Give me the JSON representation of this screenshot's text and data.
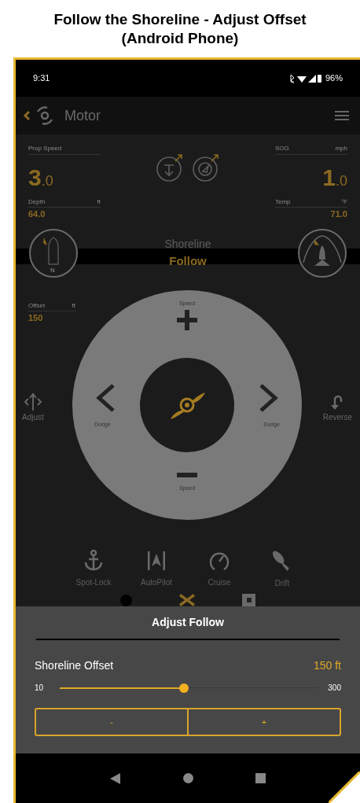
{
  "page_title": [
    "Follow the Shoreline - Adjust Offset",
    "(Android Phone)"
  ],
  "status_bar": {
    "time": "9:31",
    "battery": "96%"
  },
  "app_bar": {
    "title": "Motor"
  },
  "top_readouts": [
    {
      "label": "Prop Speed",
      "value": "3",
      "decimal": ".0"
    },
    {
      "label": "SOG",
      "unit": "mph",
      "value": "1",
      "decimal": ".0"
    }
  ],
  "small_readouts": [
    {
      "label": "Depth",
      "unit": "ft",
      "value": "64.0"
    },
    {
      "label": "Temp",
      "unit": "°F",
      "value": "71.0"
    }
  ],
  "boat_heading": {
    "marker": "N"
  },
  "mode": {
    "line_1": "Shoreline",
    "line_2": "Follow"
  },
  "offset_readout": {
    "label": "Offset",
    "unit": "ft",
    "value": "150"
  },
  "pad": {
    "top": "Speed",
    "bottom": "Speed",
    "left": "Dodge",
    "right": "Dodge"
  },
  "side_actions": [
    {
      "label": "Adjust"
    },
    {
      "label": "Reverse"
    }
  ],
  "modes": [
    {
      "kind": "anchor",
      "label": "Spot-Lock"
    },
    {
      "kind": "autopilot",
      "label": "AutoPilot"
    },
    {
      "kind": "gauge",
      "label": "Cruise"
    },
    {
      "kind": "drift",
      "label": "Drift"
    }
  ],
  "sheet": {
    "title": "Adjust Follow",
    "setting": "Shoreline Offset",
    "reading": "150 ft",
    "min": "10",
    "max": "300",
    "level": 0.48,
    "buttons": [
      "-",
      "+"
    ]
  }
}
